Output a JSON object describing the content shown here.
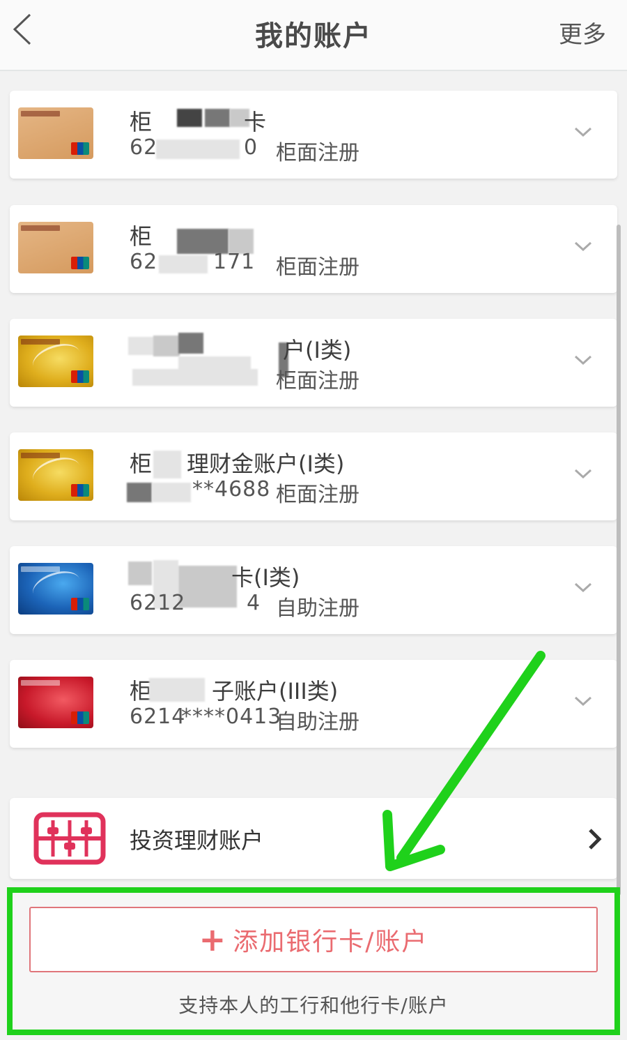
{
  "header": {
    "title": "我的账户",
    "more_label": "更多",
    "back_icon": "chevron-left-icon"
  },
  "cards": [
    {
      "name": "柜",
      "name_tail": "卡",
      "number_head": "62",
      "number_tail": "0",
      "registration": "柜面注册",
      "style": "tan"
    },
    {
      "name": "柜",
      "name_tail": "",
      "number_head": "62",
      "number_tail": "171",
      "registration": "柜面注册",
      "style": "tan"
    },
    {
      "name": "",
      "name_tail": "户(I类)",
      "number_head": "",
      "number_tail": "",
      "registration": "柜面注册",
      "style": "gold"
    },
    {
      "name": "柜",
      "name_tail": "理财金账户(I类)",
      "number_head": "",
      "number_tail": "**4688",
      "registration": "柜面注册",
      "style": "gold"
    },
    {
      "name": "",
      "name_tail": "卡(I类)",
      "number_head": "6212",
      "number_tail": "4",
      "registration": "自助注册",
      "style": "blue"
    },
    {
      "name": "柜",
      "name_tail": "子账户(III类)",
      "number_head": "6214",
      "number_tail": "****0413",
      "registration": "自助注册",
      "style": "red"
    }
  ],
  "invest": {
    "label": "投资理财账户",
    "icon": "abacus-icon",
    "arrow_icon": "chevron-right-icon"
  },
  "add_account": {
    "label": "添加银行卡/账户",
    "hint": "支持本人的工行和他行卡/账户"
  },
  "colors": {
    "accent_red": "#ea6b70",
    "highlight_green": "#1fd11b"
  }
}
